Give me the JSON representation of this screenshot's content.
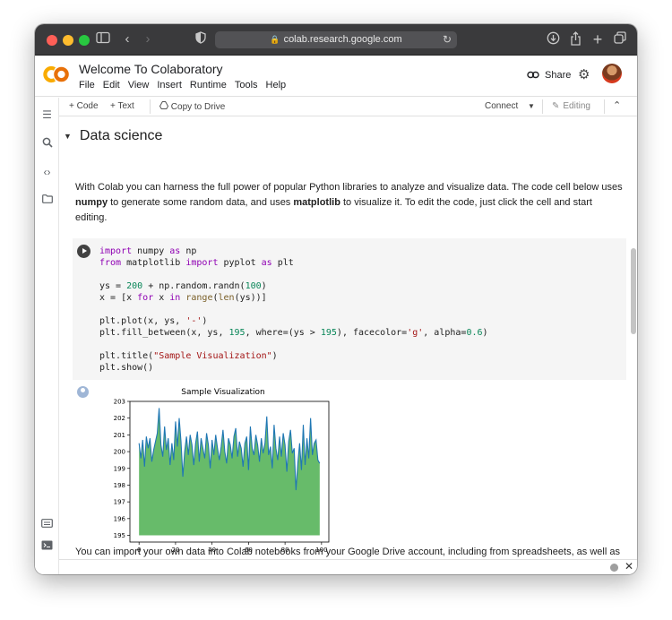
{
  "browser": {
    "address": "colab.research.google.com"
  },
  "header": {
    "title": "Welcome To Colaboratory",
    "menu": [
      "File",
      "Edit",
      "View",
      "Insert",
      "Runtime",
      "Tools",
      "Help"
    ],
    "share_label": "Share"
  },
  "toolbar": {
    "code_label": "+ Code",
    "text_label": "+ Text",
    "copy_label": "Copy to Drive",
    "connect_label": "Connect",
    "editing_label": "Editing"
  },
  "section": {
    "title": "Data science",
    "intro_1": "With Colab you can harness the full power of popular Python libraries to analyze and visualize data. The code cell below uses",
    "intro_bold_1": "numpy",
    "intro_2": "to generate some random data, and uses",
    "intro_bold_2": "matplotlib",
    "intro_3": "to visualize it. To edit the code, just click the cell and start editing.",
    "footer_text": "You can import your own data into Colab notebooks from your Google Drive account, including from spreadsheets, as well as"
  },
  "code_lines": [
    "import numpy as np",
    "from matplotlib import pyplot as plt",
    "",
    "ys = 200 + np.random.randn(100)",
    "x = [x for x in range(len(ys))]",
    "",
    "plt.plot(x, ys, '-')",
    "plt.fill_between(x, ys, 195, where=(ys > 195), facecolor='g', alpha=0.6)",
    "",
    "plt.title(\"Sample Visualization\")",
    "plt.show()"
  ],
  "colors": {
    "line": "#1f77b4",
    "fill": "#4caf50",
    "colab_orange": "#f9ab00"
  },
  "chart_data": {
    "type": "area",
    "title": "Sample Visualization",
    "xlabel": "",
    "ylabel": "",
    "xlim": [
      -5,
      104
    ],
    "ylim": [
      194.6,
      203
    ],
    "xticks": [
      0,
      20,
      40,
      60,
      80,
      100
    ],
    "yticks": [
      195,
      196,
      197,
      198,
      199,
      200,
      201,
      202,
      203
    ],
    "fill_baseline": 195,
    "x": [
      0,
      1,
      2,
      3,
      4,
      5,
      6,
      7,
      8,
      9,
      10,
      11,
      12,
      13,
      14,
      15,
      16,
      17,
      18,
      19,
      20,
      21,
      22,
      23,
      24,
      25,
      26,
      27,
      28,
      29,
      30,
      31,
      32,
      33,
      34,
      35,
      36,
      37,
      38,
      39,
      40,
      41,
      42,
      43,
      44,
      45,
      46,
      47,
      48,
      49,
      50,
      51,
      52,
      53,
      54,
      55,
      56,
      57,
      58,
      59,
      60,
      61,
      62,
      63,
      64,
      65,
      66,
      67,
      68,
      69,
      70,
      71,
      72,
      73,
      74,
      75,
      76,
      77,
      78,
      79,
      80,
      81,
      82,
      83,
      84,
      85,
      86,
      87,
      88,
      89,
      90,
      91,
      92,
      93,
      94,
      95,
      96,
      97,
      98,
      99
    ],
    "values": [
      200.5,
      199.6,
      200.7,
      199.1,
      200.9,
      200.2,
      200.8,
      199.4,
      200.1,
      200.6,
      201.1,
      202.6,
      200.4,
      199.7,
      201.5,
      200.1,
      200.8,
      199.2,
      200.5,
      199.5,
      201.8,
      200.3,
      202.0,
      200.6,
      198.5,
      200.0,
      200.9,
      199.8,
      201.0,
      200.4,
      199.2,
      200.5,
      201.2,
      199.4,
      200.8,
      200.2,
      199.6,
      201.1,
      200.4,
      199.0,
      200.7,
      199.8,
      201.0,
      200.2,
      199.5,
      200.3,
      201.3,
      200.0,
      199.3,
      200.8,
      200.4,
      199.6,
      200.9,
      201.4,
      199.7,
      200.6,
      200.2,
      199.1,
      200.5,
      200.9,
      198.9,
      201.5,
      200.2,
      199.8,
      201.0,
      200.4,
      199.4,
      200.8,
      199.9,
      200.5,
      202.1,
      199.8,
      200.3,
      199.0,
      201.6,
      200.2,
      199.5,
      200.9,
      199.7,
      201.1,
      200.4,
      198.8,
      200.6,
      201.3,
      199.9,
      200.2,
      197.7,
      199.3,
      200.5,
      198.9,
      201.6,
      199.2,
      200.8,
      199.6,
      202.0,
      199.8,
      200.5,
      200.7,
      199.5,
      199.3
    ]
  }
}
